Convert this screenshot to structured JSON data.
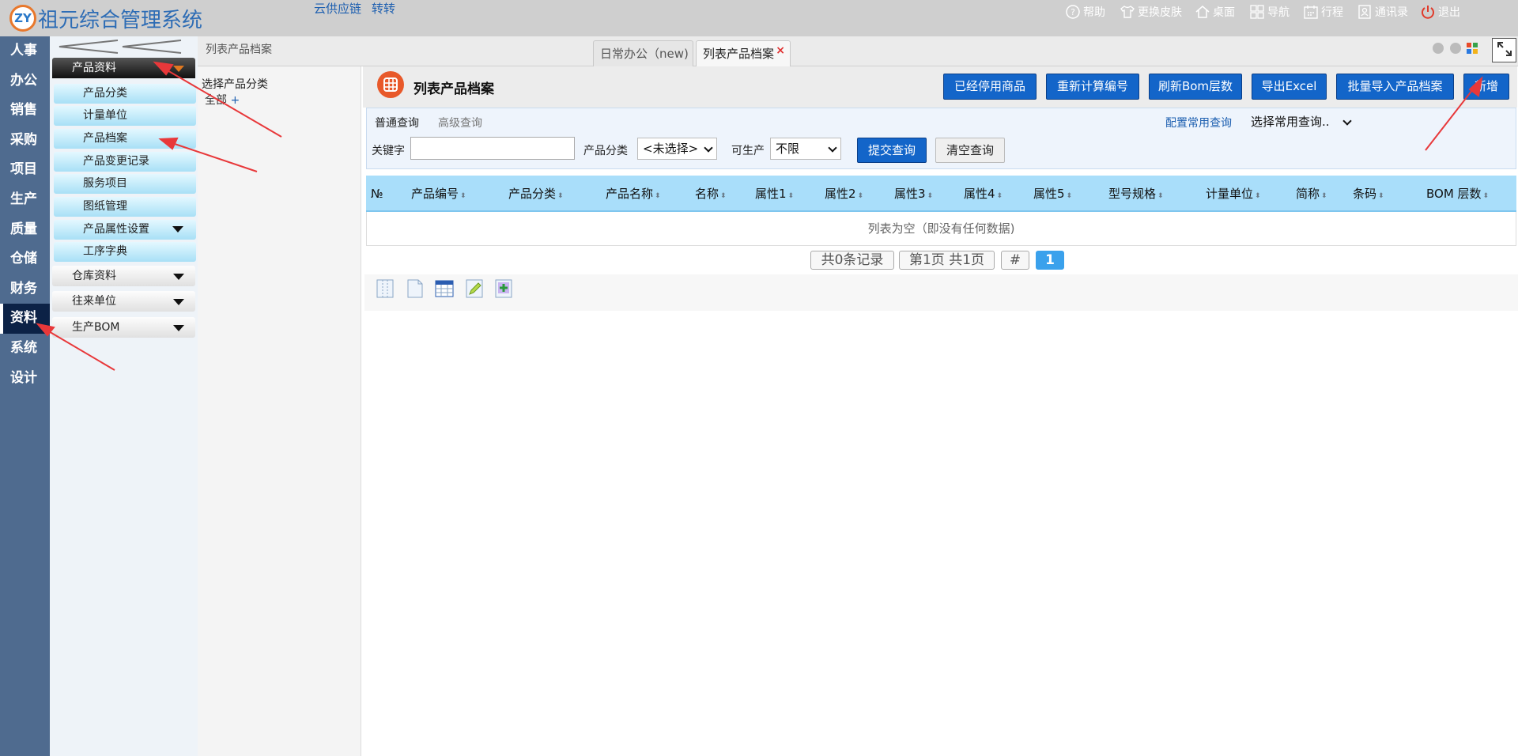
{
  "app": {
    "logo_text": "ZY",
    "title": "祖元综合管理系统",
    "top_links": [
      "云供应链",
      "转转"
    ],
    "top_actions": [
      {
        "label": "帮助",
        "icon": "help-icon"
      },
      {
        "label": "更换皮肤",
        "icon": "shirt-icon"
      },
      {
        "label": "桌面",
        "icon": "home-icon"
      },
      {
        "label": "导航",
        "icon": "grid-icon"
      },
      {
        "label": "行程",
        "icon": "calendar-icon"
      },
      {
        "label": "通讯录",
        "icon": "contacts-icon"
      },
      {
        "label": "退出",
        "icon": "power-icon"
      }
    ]
  },
  "left_nav": [
    "人事",
    "办公",
    "销售",
    "采购",
    "项目",
    "生产",
    "质量",
    "仓储",
    "财务",
    "资料",
    "系统",
    "设计"
  ],
  "left_nav_active": "资料",
  "side_menu": {
    "group_active": "产品资料",
    "items": [
      "产品分类",
      "计量单位",
      "产品档案",
      "产品变更记录",
      "服务项目",
      "图纸管理",
      "产品属性设置",
      "工序字典"
    ],
    "other_groups": [
      "仓库资料",
      "往来单位",
      "生产BOM"
    ]
  },
  "tabs": {
    "breadcrumb": "列表产品档案",
    "items": [
      {
        "label": "日常办公（new)",
        "active": false
      },
      {
        "label": "列表产品档案",
        "active": true,
        "close": "×"
      }
    ]
  },
  "tree": {
    "title": "选择产品分类",
    "root": "全部",
    "root_toggle": "+"
  },
  "page": {
    "title": "列表产品档案",
    "buttons": [
      "已经停用商品",
      "重新计算编号",
      "刷新Bom层数",
      "导出Excel",
      "批量导入产品档案",
      "新增"
    ]
  },
  "search": {
    "tabs": [
      "普通查询",
      "高级查询"
    ],
    "config_link": "配置常用查询",
    "common_select": "选择常用查询..",
    "keyword_label": "关键字",
    "keyword_value": "",
    "category_label": "产品分类",
    "category_value": "<未选择>",
    "producible_label": "可生产",
    "producible_value": "不限",
    "submit": "提交查询",
    "clear": "清空查询"
  },
  "grid": {
    "columns": [
      "№",
      "产品编号",
      "产品分类",
      "产品名称",
      "名称",
      "属性1",
      "属性2",
      "属性3",
      "属性4",
      "属性5",
      "型号规格",
      "计量单位",
      "简称",
      "条码",
      "BOM 层数"
    ],
    "empty_text": "列表为空（即没有任何数据)"
  },
  "pager": {
    "total": "共0条记录",
    "page_info": "第1页 共1页",
    "jump": "#",
    "current": "1"
  },
  "colors": {
    "primary_button": "#1365c9",
    "nav_bg": "#4f6b8f",
    "grid_header": "#a9defa",
    "annotation_arrow": "#e8383a"
  }
}
